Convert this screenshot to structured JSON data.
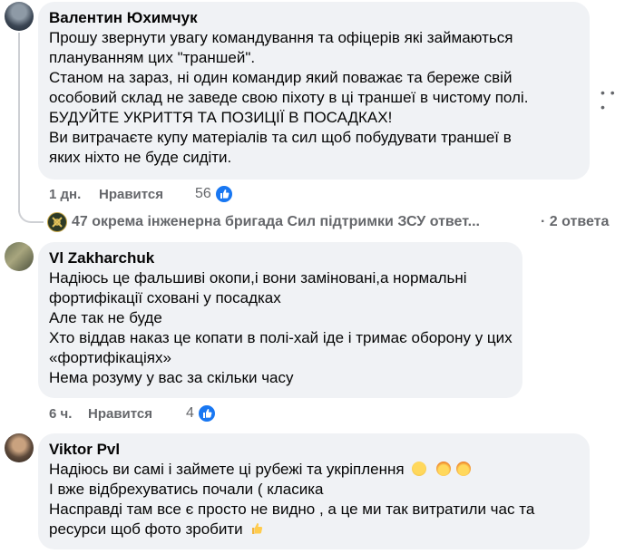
{
  "comments": [
    {
      "author": "Валентин Юхимчук",
      "lines": [
        "Прошу звернути увагу командування та офіцерів які займаються",
        "плануванням цих \"траншей\".",
        "Станом на зараз, ні один командир який поважає та береже свій",
        "особовий склад не заведе свою піхоту в ці траншеї в чистому полі.",
        "БУДУЙТЕ УКРИТТЯ ТА ПОЗИЦІЇ В ПОСАДКАХ!",
        "Ви витрачаєте купу матеріалів та сил щоб побудувати траншеї в",
        "яких ніхто не буде сидіти."
      ],
      "time": "1 дн.",
      "like_label": "Нравится",
      "reaction_count": "56",
      "replies": {
        "author": "47 окрема інженерна бригада Сил підтримки ЗСУ ответ...",
        "count": "· 2 ответа"
      }
    },
    {
      "author": "Vl Zakharchuk",
      "lines": [
        "Надіюсь це фальшиві окопи,і вони заміновані,а нормальні",
        "фортифікації сховані у посадках",
        "Але так не буде",
        "Хто віддав наказ це копати в полі-хай іде і тримає оборону у цих",
        "«фортифікаціях»",
        "Нема розуму у вас за скільки часу"
      ],
      "time": "6 ч.",
      "like_label": "Нравится",
      "reaction_count": "4"
    },
    {
      "author": "Viktor Pvl",
      "lines": [
        "Надіюсь ви самі і займете ці рубежі та укріплення",
        "І вже відбрехуватись почали ( класика",
        "Насправді там все є просто не видно , а це ми так витратили час та",
        "ресурси щоб фото зробити"
      ]
    }
  ],
  "icons": {
    "more": "more-horizontal-icon",
    "like": "thumbs-up-icon",
    "emoji_fear": "fearful-face-emoji",
    "emoji_shock": "exploding-head-emoji",
    "emoji_thumb": "thumbs-up-emoji"
  },
  "colors": {
    "bubble": "#f0f2f5",
    "meta": "#65676b",
    "like": "#1877f2"
  }
}
